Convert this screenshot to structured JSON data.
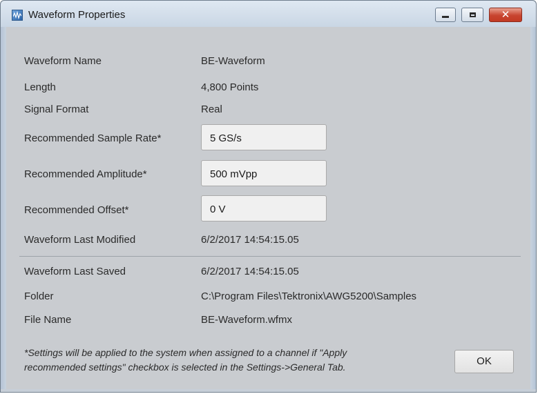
{
  "window": {
    "title": "Waveform Properties",
    "close_label": "✕"
  },
  "properties": {
    "waveform_name_label": "Waveform Name",
    "waveform_name_value": "BE-Waveform",
    "length_label": "Length",
    "length_value": "4,800 Points",
    "signal_format_label": "Signal Format",
    "signal_format_value": "Real",
    "sample_rate_label": "Recommended Sample Rate*",
    "sample_rate_value": "5 GS/s",
    "amplitude_label": "Recommended Amplitude*",
    "amplitude_value": "500 mVpp",
    "offset_label": "Recommended Offset*",
    "offset_value": "0 V",
    "last_modified_label": "Waveform Last Modified",
    "last_modified_value": "6/2/2017 14:54:15.05",
    "last_saved_label": "Waveform Last Saved",
    "last_saved_value": "6/2/2017 14:54:15.05",
    "folder_label": "Folder",
    "folder_value": "C:\\Program Files\\Tektronix\\AWG5200\\Samples",
    "file_name_label": "File Name",
    "file_name_value": "BE-Waveform.wfmx"
  },
  "footer": {
    "note_line1": "*Settings will be applied to the system when assigned to a channel if \"Apply",
    "note_line2": "recommended settings\" checkbox is selected in the Settings->General Tab.",
    "ok_label": "OK"
  },
  "icons": {
    "app": "waveform-app-icon",
    "minimize": "minimize-icon",
    "maximize": "maximize-icon",
    "close": "close-icon"
  }
}
